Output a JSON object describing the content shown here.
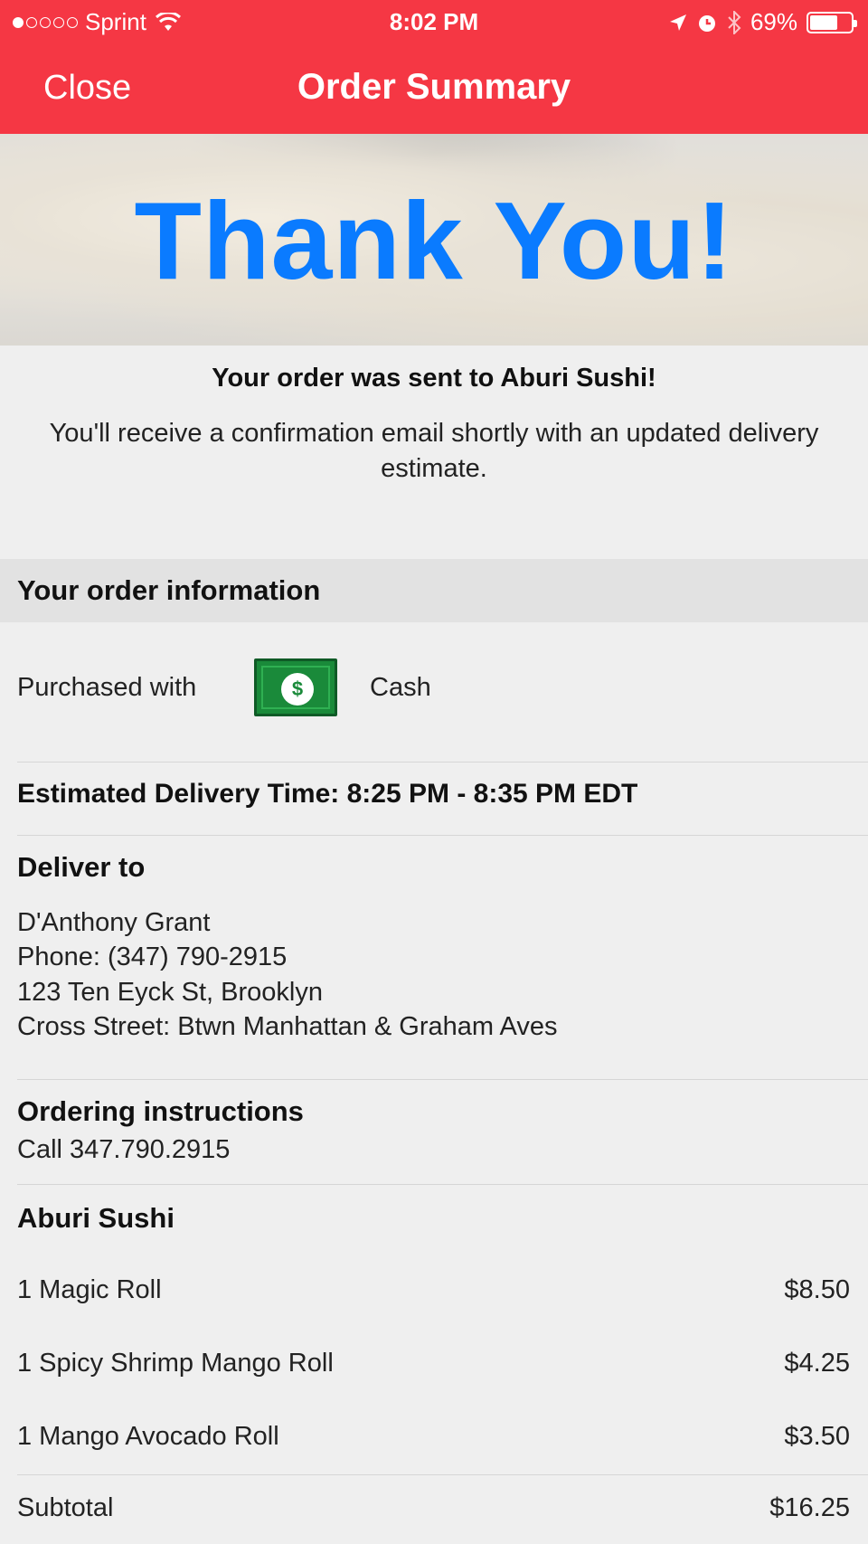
{
  "status_bar": {
    "carrier": "Sprint",
    "time": "8:02 PM",
    "battery": "69%",
    "battery_level": 0.69
  },
  "nav": {
    "close_label": "Close",
    "title": "Order Summary"
  },
  "hero": {
    "thanks": "Thank You!"
  },
  "confirmation": {
    "title": "Your order was sent to Aburi Sushi!",
    "body": "You'll receive a confirmation email shortly with an updated delivery estimate."
  },
  "order_info": {
    "header": "Your order information",
    "purchased_with_label": "Purchased with",
    "payment_method": "Cash",
    "payment_icon_symbol": "$",
    "delivery_time": "Estimated Delivery Time: 8:25 PM - 8:35 PM EDT",
    "deliver_to_label": "Deliver to",
    "address_lines": [
      "D'Anthony Grant",
      "Phone: (347) 790-2915",
      "123 Ten Eyck St, Brooklyn",
      "Cross Street: Btwn Manhattan & Graham Aves"
    ],
    "instructions_label": "Ordering instructions",
    "instructions": "Call 347.790.2915",
    "restaurant": "Aburi Sushi",
    "items": [
      {
        "name": "1 Magic Roll",
        "price": "$8.50"
      },
      {
        "name": "1 Spicy Shrimp Mango Roll",
        "price": "$4.25"
      },
      {
        "name": "1 Mango Avocado Roll",
        "price": "$3.50"
      }
    ],
    "subtotal_label": "Subtotal",
    "subtotal": "$16.25"
  }
}
